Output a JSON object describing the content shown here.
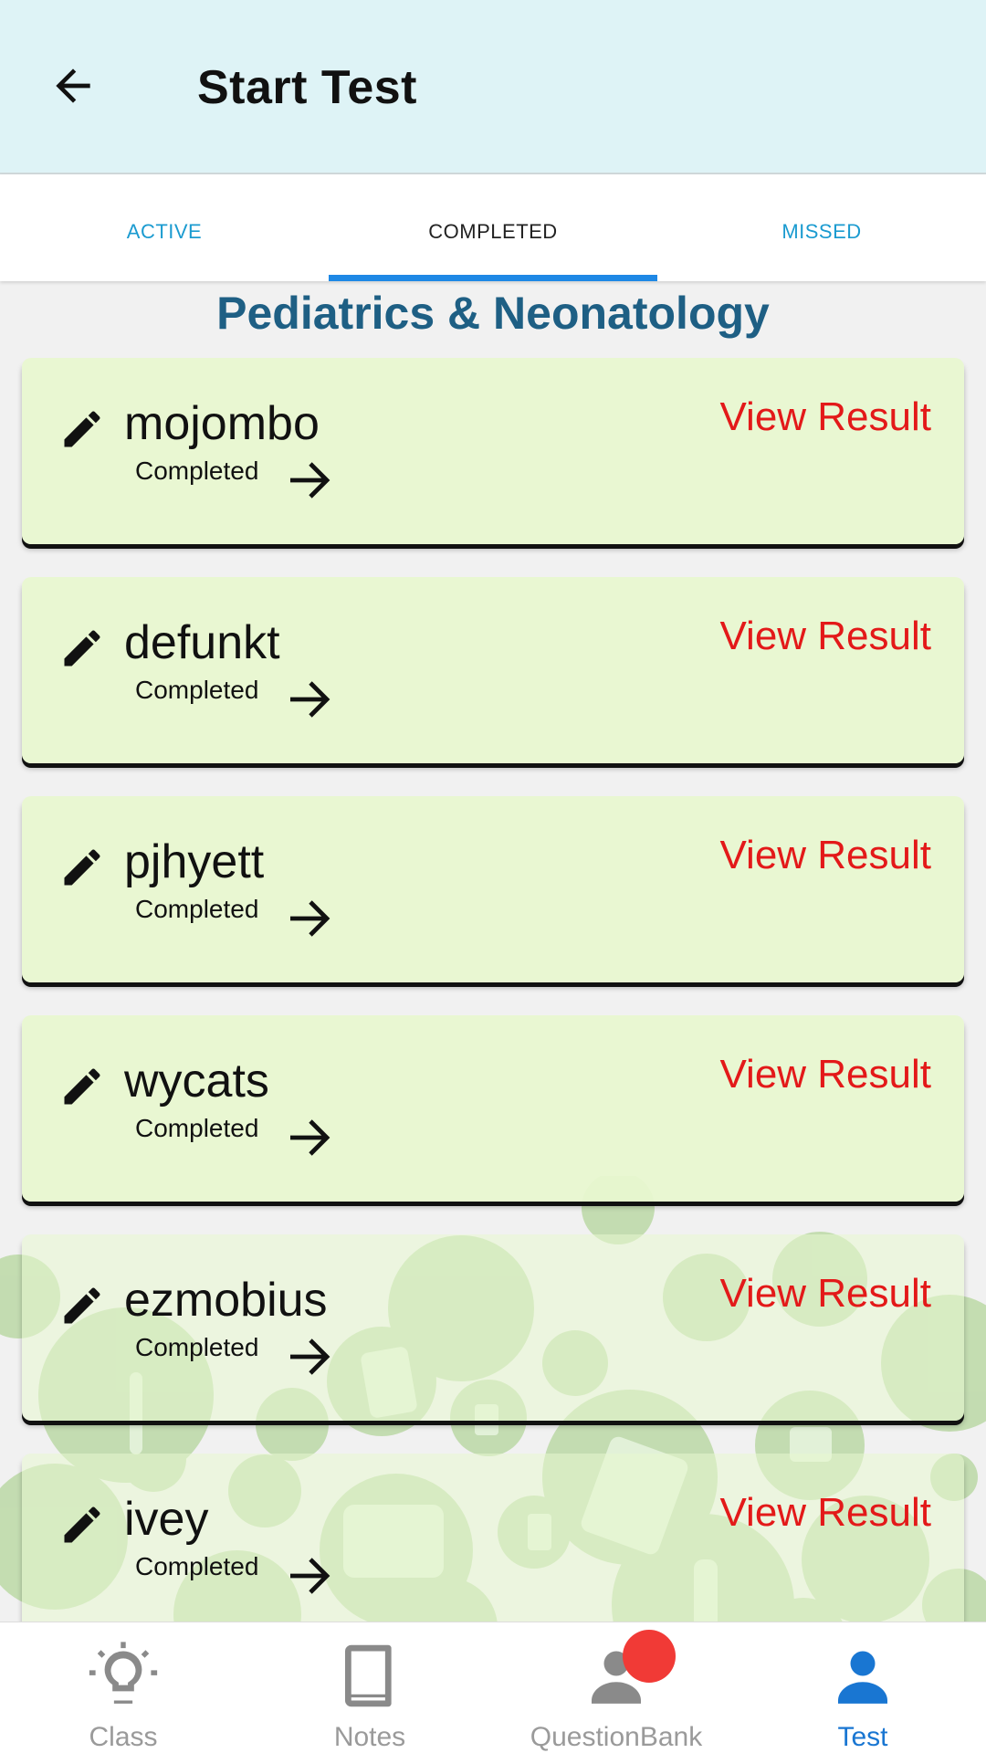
{
  "appbar": {
    "title": "Start Test"
  },
  "tabs": [
    {
      "label": "ACTIVE",
      "selected": false
    },
    {
      "label": "COMPLETED",
      "selected": true
    },
    {
      "label": "MISSED",
      "selected": false
    }
  ],
  "section": {
    "title": "Pediatrics & Neonatology"
  },
  "tests": [
    {
      "name": "mojombo",
      "status": "Completed",
      "action": "View Result"
    },
    {
      "name": "defunkt",
      "status": "Completed",
      "action": "View Result"
    },
    {
      "name": "pjhyett",
      "status": "Completed",
      "action": "View Result"
    },
    {
      "name": "wycats",
      "status": "Completed",
      "action": "View Result"
    },
    {
      "name": "ezmobius",
      "status": "Completed",
      "action": "View Result"
    },
    {
      "name": "ivey",
      "status": "Completed",
      "action": "View Result"
    }
  ],
  "bottom_nav": [
    {
      "label": "Class",
      "icon": "lightbulb-icon",
      "active": false
    },
    {
      "label": "Notes",
      "icon": "book-icon",
      "active": false
    },
    {
      "label": "QuestionBank",
      "icon": "person-icon",
      "active": false
    },
    {
      "label": "Test",
      "icon": "person-icon",
      "active": true
    }
  ],
  "colors": {
    "appbar_bg": "#def3f6",
    "card_bg": "#e8f7d0",
    "accent_blue": "#1e88e5",
    "title_blue": "#1e5f84",
    "view_result_red": "#e31919",
    "badge_red": "#f13a36"
  }
}
